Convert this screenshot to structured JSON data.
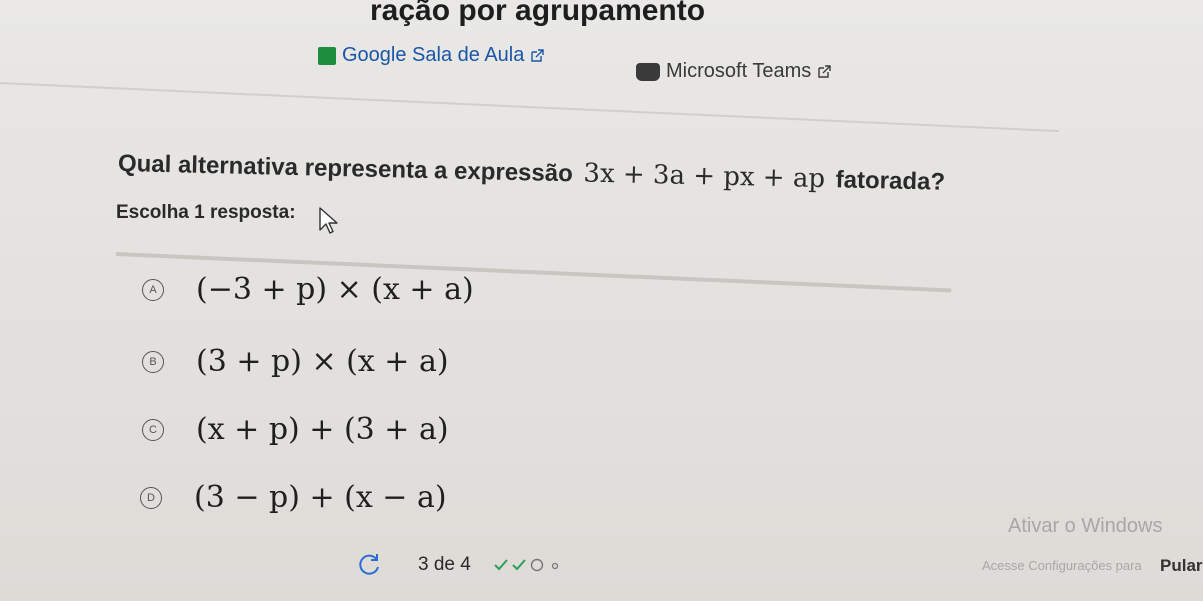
{
  "header": {
    "title": "ração por agrupamento",
    "links": [
      {
        "label": "Google Sala de Aula",
        "icon": "google-classroom-icon",
        "color": "#1a56a8"
      },
      {
        "label": "Microsoft Teams",
        "icon": "microsoft-teams-icon",
        "color": "#3a3a3a"
      }
    ]
  },
  "question": {
    "prefix": "Qual alternativa representa a expressão",
    "expression": "3x + 3a + px + ap",
    "suffix": "fatorada?",
    "instruction": "Escolha 1 resposta:"
  },
  "options": [
    {
      "letter": "A",
      "expression": "(−3 + p) × (x + a)"
    },
    {
      "letter": "B",
      "expression": "(3 + p) × (x + a)"
    },
    {
      "letter": "C",
      "expression": "(x + p) + (3 + a)"
    },
    {
      "letter": "D",
      "expression": "(3 − p) + (x − a)"
    }
  ],
  "footer": {
    "progress": "3 de 4",
    "steps": [
      "check",
      "check",
      "circle",
      "dot"
    ],
    "skip_label": "Pular"
  },
  "watermark": {
    "title": "Ativar o Windows",
    "subtitle": "Acesse Configurações para"
  }
}
